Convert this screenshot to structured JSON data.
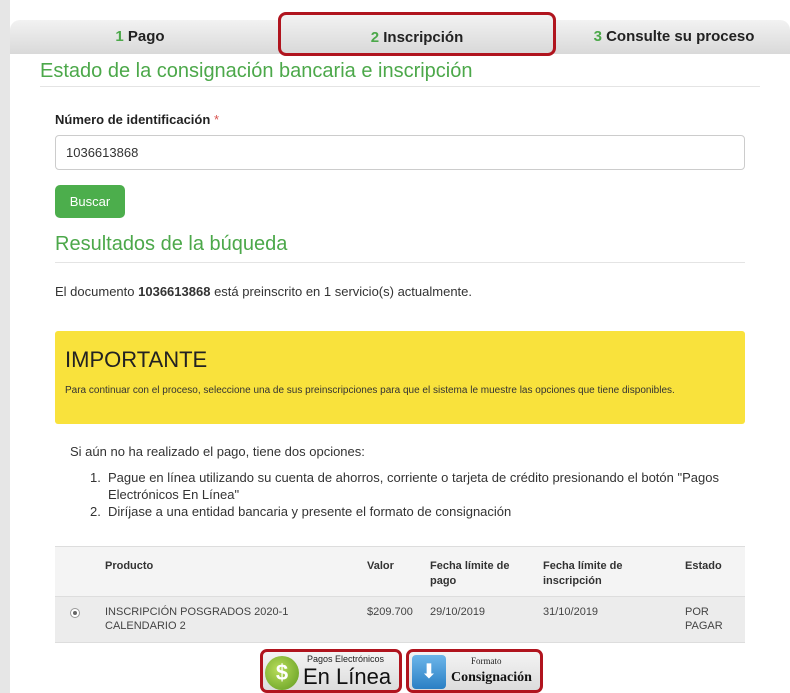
{
  "steps": [
    {
      "num": "1",
      "label": "Pago"
    },
    {
      "num": "2",
      "label": "Inscripción"
    },
    {
      "num": "3",
      "label": "Consulte su proceso"
    }
  ],
  "header": {
    "title": "Estado de la consignación bancaria e inscripción"
  },
  "form": {
    "id_label": "Número de identificación",
    "required_mark": "*",
    "id_value": "1036613868",
    "search_button": "Buscar"
  },
  "results": {
    "title": "Resultados de la búqueda",
    "summary_prefix": "El documento",
    "summary_doc": "1036613868",
    "summary_suffix": "está preinscrito en 1 servicio(s) actualmente."
  },
  "important": {
    "title": "IMPORTANTE",
    "text": "Para continuar con el proceso, seleccione una de sus preinscripciones para que el sistema le muestre las opciones que tiene disponibles."
  },
  "payment_info": {
    "intro": "Si aún no ha realizado el pago, tiene dos opciones:",
    "options": [
      "Pague en línea utilizando su cuenta de ahorros, corriente o tarjeta de crédito presionando el botón \"Pagos Electrónicos En Línea\"",
      "Diríjase a una entidad bancaria y presente el formato de consignación"
    ]
  },
  "table": {
    "headers": [
      "Producto",
      "Valor",
      "Fecha límite de pago",
      "Fecha límite de inscripción",
      "Estado"
    ],
    "rows": [
      {
        "producto": "INSCRIPCIÓN POSGRADOS 2020-1 CALENDARIO 2",
        "valor": "$209.700",
        "fecha_pago": "29/10/2019",
        "fecha_inscripcion": "31/10/2019",
        "estado": "POR PAGAR",
        "selected": true
      }
    ]
  },
  "buttons": {
    "online_small": "Pagos Electrónicos",
    "online_big": "En Línea",
    "consig_small": "Formato",
    "consig_big": "Consignación"
  },
  "colors": {
    "accent": "#4ca84a",
    "highlight_border": "#b0141e",
    "important_bg": "#f9e23c"
  }
}
